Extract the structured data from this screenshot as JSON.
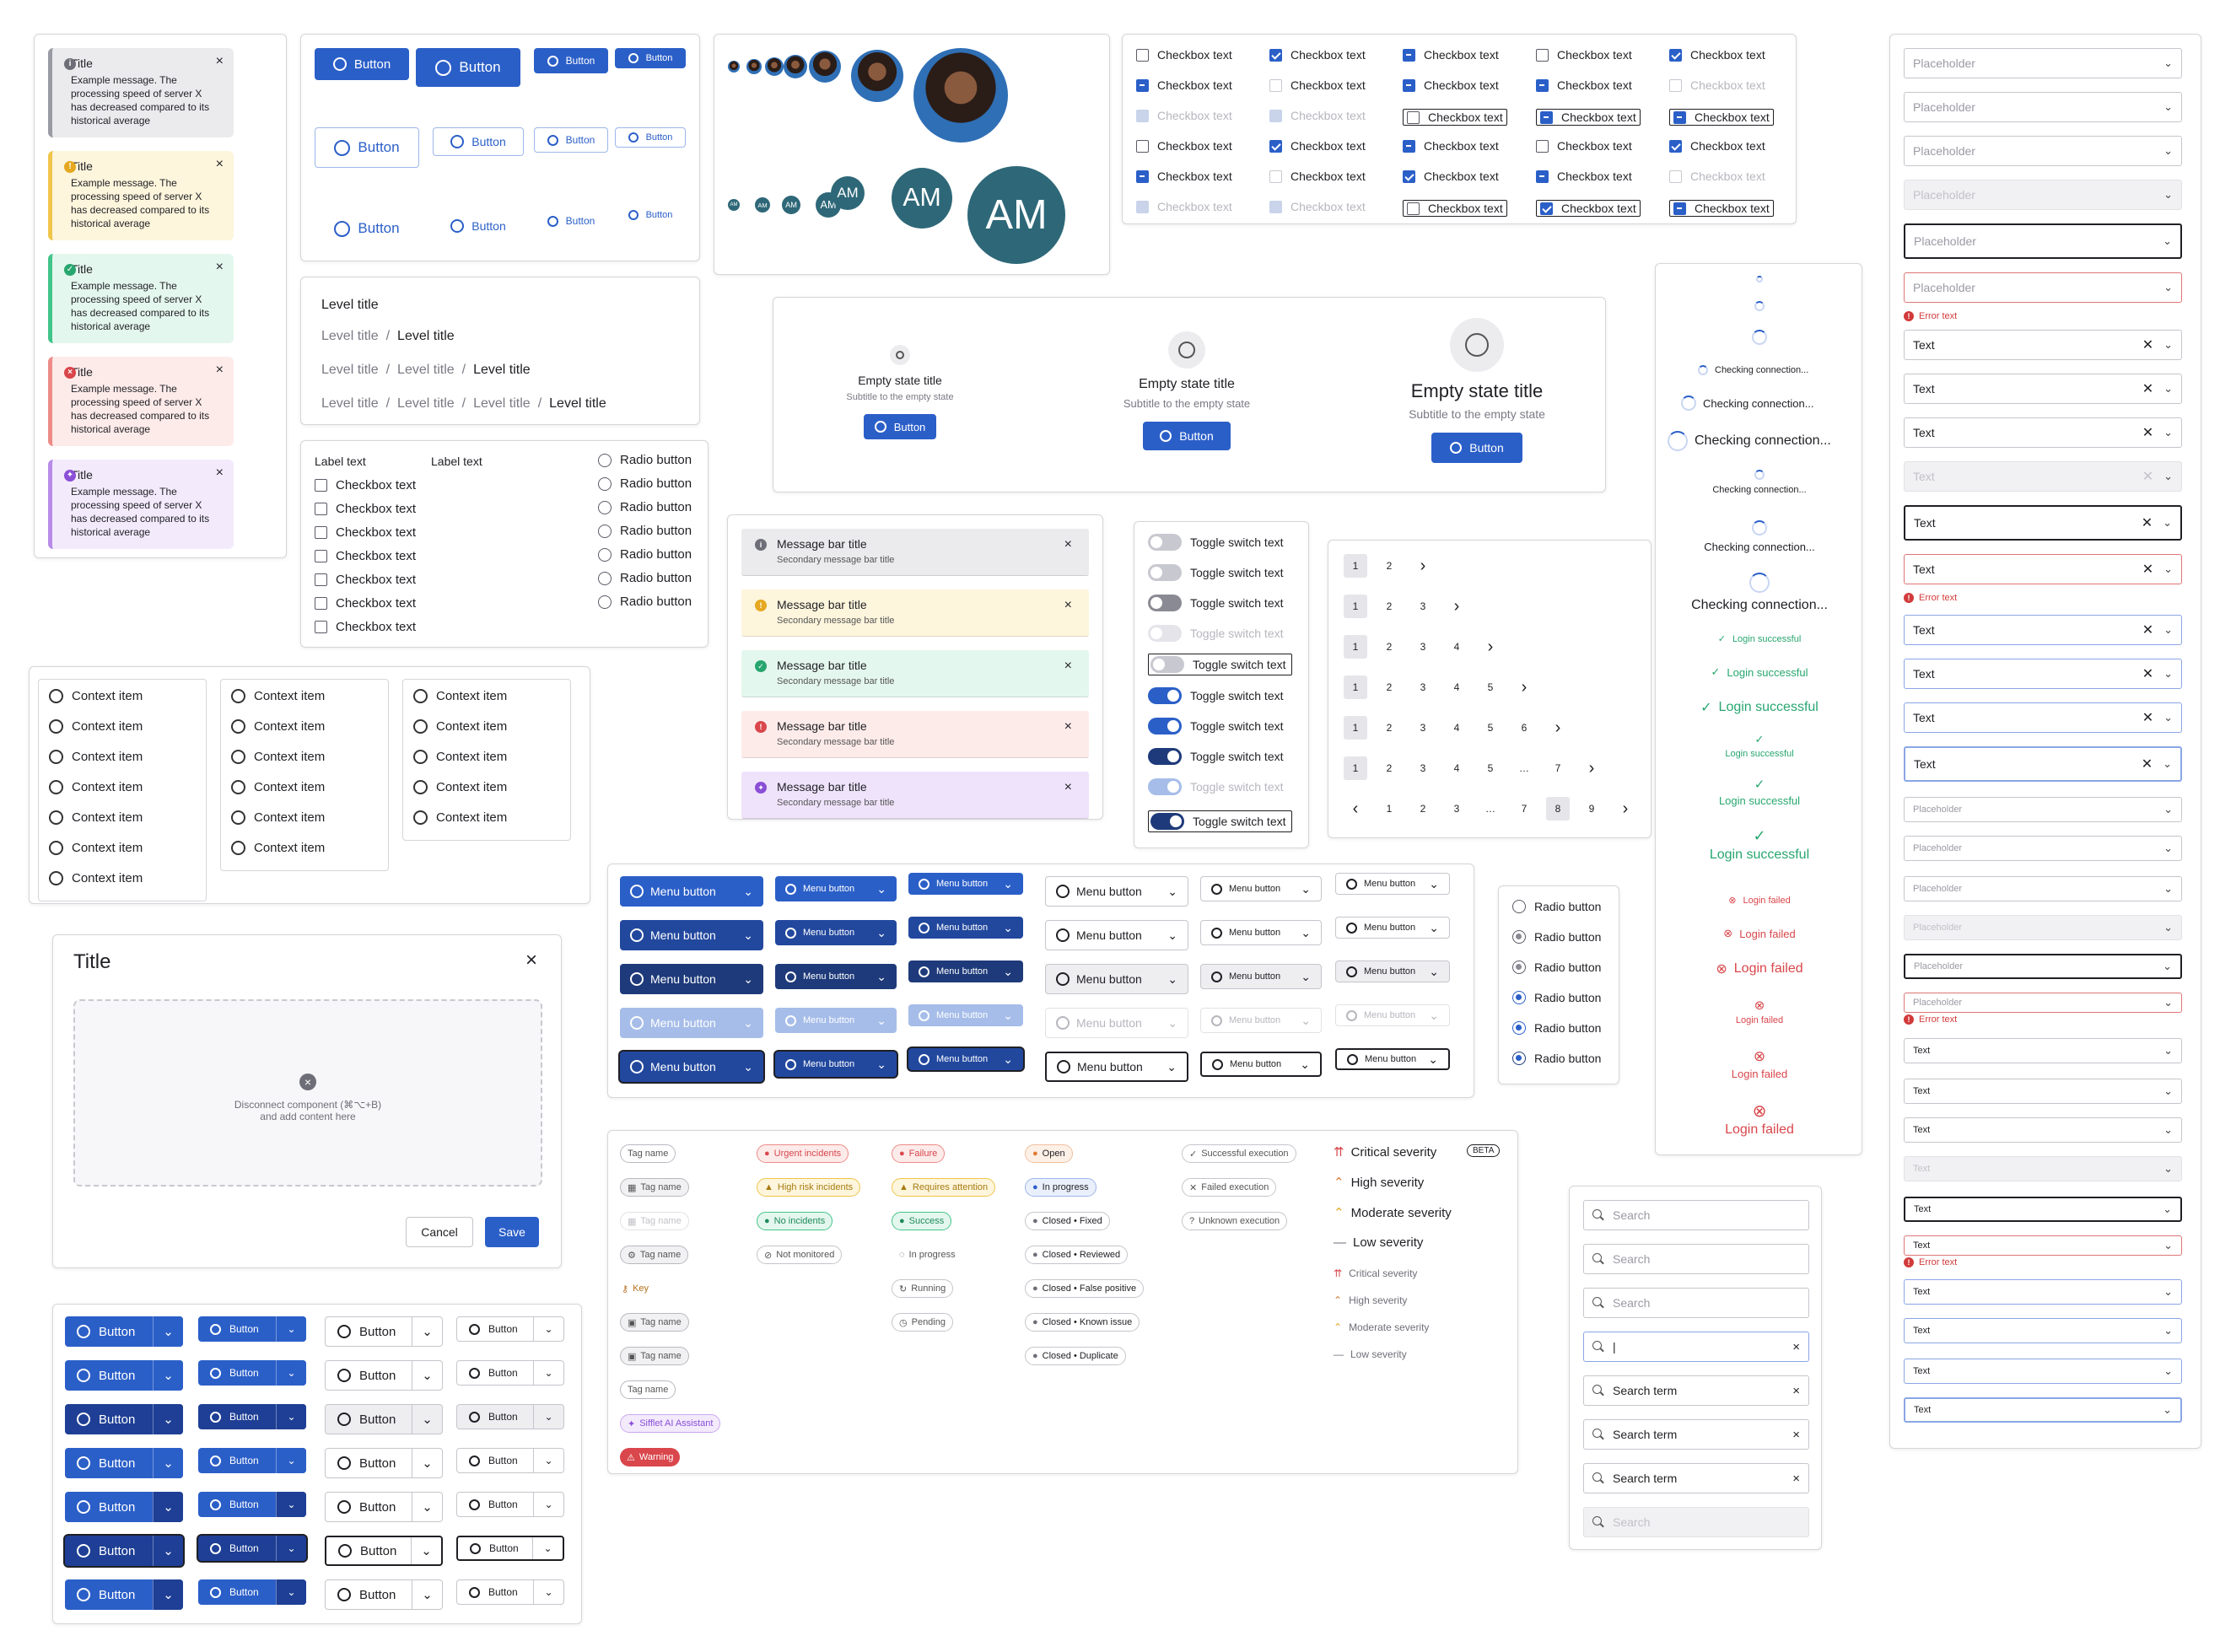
{
  "message_cards": [
    {
      "title": "Title",
      "body": "Example message. The processing speed of server X has decreased compared to its historical average",
      "icon": "info-icon",
      "bg": "#ebebee",
      "border": "#9a9aa4",
      "iconbg": "#6e6e78"
    },
    {
      "title": "Title",
      "body": "Example message. The processing speed of server X has decreased compared to its historical average",
      "icon": "warning-icon",
      "bg": "#fdf5dc",
      "border": "#f0c64a",
      "iconbg": "#e5a820"
    },
    {
      "title": "Title",
      "body": "Example message. The processing speed of server X has decreased compared to its historical average",
      "icon": "success-icon",
      "bg": "#e4f7ee",
      "border": "#42c48a",
      "iconbg": "#27a66f"
    },
    {
      "title": "Title",
      "body": "Example message. The processing speed of server X has decreased compared to its historical average",
      "icon": "error-icon",
      "bg": "#fdebea",
      "border": "#ec8b87",
      "iconbg": "#d9464b"
    },
    {
      "title": "Title",
      "body": "Example message. The processing speed of server X has decreased compared to its historical average",
      "icon": "sparkle-icon",
      "bg": "#f3eafc",
      "border": "#b78be8",
      "iconbg": "#8a4fd6"
    }
  ],
  "close_glyph": "×",
  "button_label": "Button",
  "breadcrumb": {
    "level": "Level title",
    "sep": "/"
  },
  "checklist": {
    "label": "Label text",
    "cb": "Checkbox text",
    "radio": "Radio button"
  },
  "context_item": "Context item",
  "dialog": {
    "title": "Title",
    "drop_text": "Disconnect component (⌘⌥+B)",
    "drop_text2": "and add content here",
    "cancel": "Cancel",
    "save": "Save"
  },
  "avatars": {
    "initials": "AM"
  },
  "checkbox_grid_label": "Checkbox text",
  "empty_state": {
    "title": "Empty state title",
    "subtitle": "Subtitle to the empty state",
    "button": "Button"
  },
  "message_bars": [
    {
      "title": "Message bar title",
      "sub": "Secondary message bar title",
      "bg": "#ebebee",
      "icon": "#6e6e78",
      "glyph": "i"
    },
    {
      "title": "Message bar title",
      "sub": "Secondary message bar title",
      "bg": "#fdf5dc",
      "icon": "#e5a820",
      "glyph": "!"
    },
    {
      "title": "Message bar title",
      "sub": "Secondary message bar title",
      "bg": "#e4f7ee",
      "icon": "#27a66f",
      "glyph": "✓"
    },
    {
      "title": "Message bar title",
      "sub": "Secondary message bar title",
      "bg": "#fdebea",
      "icon": "#d9464b",
      "glyph": "!"
    },
    {
      "title": "Message bar title",
      "sub": "Secondary message bar title",
      "bg": "#efe3fb",
      "icon": "#8a4fd6",
      "glyph": "✦"
    }
  ],
  "toggle_label": "Toggle switch text",
  "pagination": {
    "ellipsis": "…"
  },
  "menu_button": "Menu button",
  "radio_label": "Radio button",
  "tags": {
    "tag_name": "Tag name",
    "key": "Key",
    "sifflet": "Sifflet AI Assistant",
    "warning": "Warning",
    "urgent": "Urgent incidents",
    "high_risk": "High risk incidents",
    "no_incidents": "No incidents",
    "not_monitored": "Not monitored",
    "failure": "Failure",
    "requires": "Requires attention",
    "success": "Success",
    "in_progress": "In progress",
    "running": "Running",
    "pending": "Pending",
    "open": "Open",
    "in_progress2": "In progress",
    "closed_fixed": "Closed • Fixed",
    "closed_reviewed": "Closed • Reviewed",
    "closed_fp": "Closed • False positive",
    "closed_ki": "Closed • Known issue",
    "closed_dup": "Closed • Duplicate",
    "succ_exec": "Successful execution",
    "failed_exec": "Failed execution",
    "unknown_exec": "Unknown execution",
    "critical": "Critical severity",
    "high": "High severity",
    "moderate": "Moderate severity",
    "low": "Low severity",
    "beta": "BETA"
  },
  "loading": {
    "checking": "Checking connection...",
    "ok": "Login successful",
    "fail": "Login failed"
  },
  "search": {
    "placeholder": "Search",
    "cursor": "|",
    "term": "Search term"
  },
  "selects": {
    "placeholder": "Placeholder",
    "text": "Text",
    "error": "Error text"
  }
}
